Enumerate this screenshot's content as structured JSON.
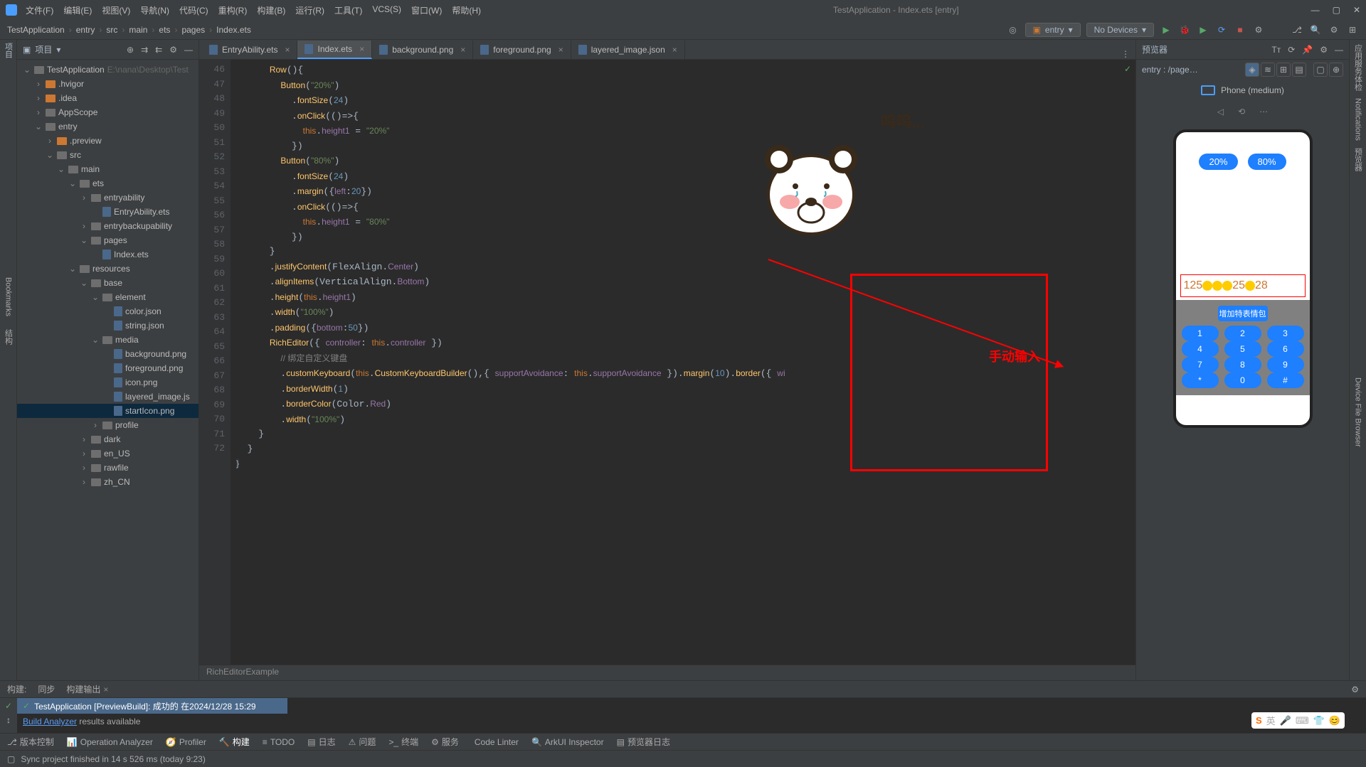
{
  "title": "TestApplication - Index.ets [entry]",
  "menus": [
    "文件(F)",
    "编辑(E)",
    "视图(V)",
    "导航(N)",
    "代码(C)",
    "重构(R)",
    "构建(B)",
    "运行(R)",
    "工具(T)",
    "VCS(S)",
    "窗口(W)",
    "帮助(H)"
  ],
  "breadcrumb": [
    "TestApplication",
    "entry",
    "src",
    "main",
    "ets",
    "pages",
    "Index.ets"
  ],
  "runConfig": "entry",
  "deviceSel": "No Devices",
  "projectPanel": {
    "title": "项目"
  },
  "tree": [
    {
      "d": 0,
      "a": "v",
      "ic": "folder gray",
      "label": "TestApplication",
      "dim": "E:\\nana\\Desktop\\Test"
    },
    {
      "d": 1,
      "a": ">",
      "ic": "folder orange",
      "label": ".hvigor"
    },
    {
      "d": 1,
      "a": ">",
      "ic": "folder orange",
      "label": ".idea"
    },
    {
      "d": 1,
      "a": ">",
      "ic": "folder gray",
      "label": "AppScope"
    },
    {
      "d": 1,
      "a": "v",
      "ic": "folder gray",
      "label": "entry"
    },
    {
      "d": 2,
      "a": ">",
      "ic": "folder orange",
      "label": ".preview"
    },
    {
      "d": 2,
      "a": "v",
      "ic": "folder gray",
      "label": "src"
    },
    {
      "d": 3,
      "a": "v",
      "ic": "folder gray",
      "label": "main"
    },
    {
      "d": 4,
      "a": "v",
      "ic": "folder gray",
      "label": "ets"
    },
    {
      "d": 5,
      "a": ">",
      "ic": "folder gray",
      "label": "entryability"
    },
    {
      "d": 6,
      "a": "",
      "ic": "file",
      "label": "EntryAbility.ets"
    },
    {
      "d": 5,
      "a": ">",
      "ic": "folder gray",
      "label": "entrybackupability"
    },
    {
      "d": 5,
      "a": "v",
      "ic": "folder gray",
      "label": "pages"
    },
    {
      "d": 6,
      "a": "",
      "ic": "file",
      "label": "Index.ets"
    },
    {
      "d": 4,
      "a": "v",
      "ic": "folder gray",
      "label": "resources"
    },
    {
      "d": 5,
      "a": "v",
      "ic": "folder gray",
      "label": "base"
    },
    {
      "d": 6,
      "a": "v",
      "ic": "folder gray",
      "label": "element"
    },
    {
      "d": 7,
      "a": "",
      "ic": "file",
      "label": "color.json"
    },
    {
      "d": 7,
      "a": "",
      "ic": "file",
      "label": "string.json"
    },
    {
      "d": 6,
      "a": "v",
      "ic": "folder gray",
      "label": "media"
    },
    {
      "d": 7,
      "a": "",
      "ic": "file",
      "label": "background.png"
    },
    {
      "d": 7,
      "a": "",
      "ic": "file",
      "label": "foreground.png"
    },
    {
      "d": 7,
      "a": "",
      "ic": "file",
      "label": "icon.png"
    },
    {
      "d": 7,
      "a": "",
      "ic": "file",
      "label": "layered_image.js"
    },
    {
      "d": 7,
      "a": "",
      "ic": "file",
      "label": "startIcon.png",
      "sel": true
    },
    {
      "d": 6,
      "a": ">",
      "ic": "folder gray",
      "label": "profile"
    },
    {
      "d": 5,
      "a": ">",
      "ic": "folder gray",
      "label": "dark"
    },
    {
      "d": 5,
      "a": ">",
      "ic": "folder gray",
      "label": "en_US"
    },
    {
      "d": 5,
      "a": ">",
      "ic": "folder gray",
      "label": "rawfile"
    },
    {
      "d": 5,
      "a": ">",
      "ic": "folder gray",
      "label": "zh_CN"
    }
  ],
  "tabs": [
    {
      "label": "EntryAbility.ets",
      "active": false
    },
    {
      "label": "Index.ets",
      "active": true
    },
    {
      "label": "background.png",
      "active": false
    },
    {
      "label": "foreground.png",
      "active": false
    },
    {
      "label": "layered_image.json",
      "active": false
    }
  ],
  "lineStart": 46,
  "lineEnd": 72,
  "codeBreadcrumb": "RichEditorExample",
  "preview": {
    "title": "预览器",
    "entry": "entry : /page…",
    "device": "Phone (medium)",
    "btn20": "20%",
    "btn80": "80%",
    "editorText": "125😊😊😊25😊28",
    "kbHeader": "增加特表情包",
    "keys": [
      [
        "1",
        "2",
        "3"
      ],
      [
        "4",
        "5",
        "6"
      ],
      [
        "7",
        "8",
        "9"
      ],
      [
        "*",
        "0",
        "#"
      ]
    ]
  },
  "sticker": "呜呜...",
  "redText": "手动输入",
  "buildTabs": {
    "build": "构建:",
    "sync": "同步",
    "output": "构建输出"
  },
  "buildStatus": "TestApplication [PreviewBuild]: 成功的 在2024/12/28 15:29",
  "buildMsg": {
    "link": "Build Analyzer",
    "rest": " results available"
  },
  "bottomTools": [
    "版本控制",
    "Operation Analyzer",
    "Profiler",
    "构建",
    "TODO",
    "日志",
    "问题",
    "终端",
    "服务",
    "Code Linter",
    "ArkUI Inspector",
    "预览器日志"
  ],
  "statusMsg": "Sync project finished in 14 s 526 ms (today 9:23)",
  "ime": "英",
  "leftStripLabels": {
    "bookmarks": "Bookmarks",
    "structure": "结构",
    "project": "项目"
  },
  "rightStripLabels": {
    "assistant": "应用服务体检",
    "notifications": "Notifications",
    "preview": "预览器",
    "browser": "Device File Browser"
  }
}
